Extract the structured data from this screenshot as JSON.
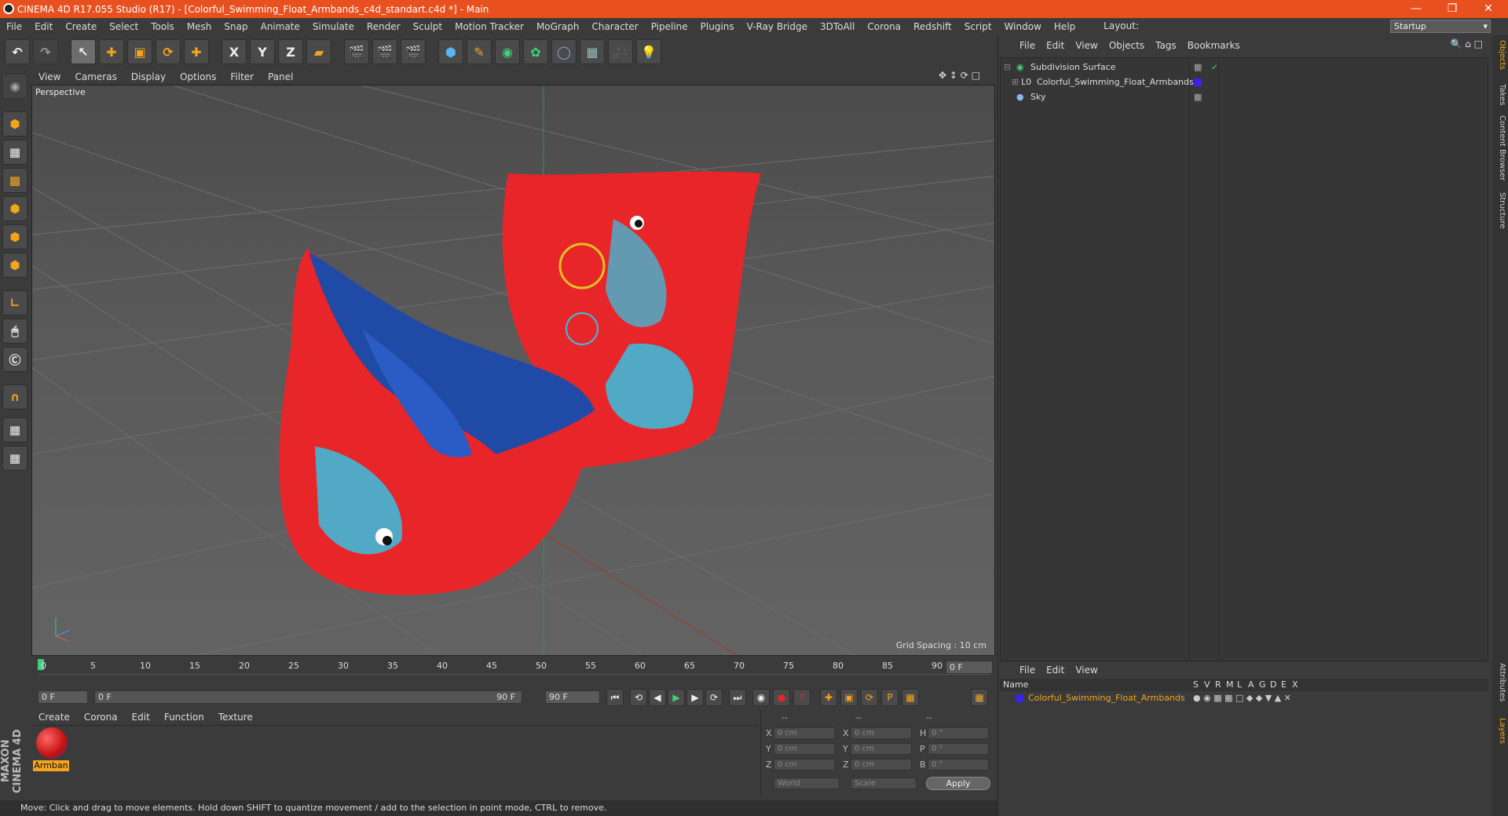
{
  "title": "CINEMA 4D R17.055 Studio (R17) - [Colorful_Swimming_Float_Armbands_c4d_standart.c4d *] - Main",
  "menu": [
    "File",
    "Edit",
    "Create",
    "Select",
    "Tools",
    "Mesh",
    "Snap",
    "Animate",
    "Simulate",
    "Render",
    "Sculpt",
    "Motion Tracker",
    "MoGraph",
    "Character",
    "Pipeline",
    "Plugins",
    "V-Ray Bridge",
    "3DToAll",
    "Corona",
    "Redshift",
    "Script",
    "Window",
    "Help"
  ],
  "layout": {
    "label": "Layout:",
    "value": "Startup"
  },
  "toolbar_axes": [
    "X",
    "Y",
    "Z"
  ],
  "viewport": {
    "menu": [
      "View",
      "Cameras",
      "Display",
      "Options",
      "Filter",
      "Panel"
    ],
    "label": "Perspective",
    "grid_spacing": "Grid Spacing : 10 cm"
  },
  "timeline": {
    "ticks": [
      "0",
      "5",
      "10",
      "15",
      "20",
      "25",
      "30",
      "35",
      "40",
      "45",
      "50",
      "55",
      "60",
      "65",
      "70",
      "75",
      "80",
      "85",
      "90"
    ],
    "frame_end_field": "0 F",
    "start": "0 F",
    "range_start": "0 F",
    "range_end": "90 F",
    "end": "90 F"
  },
  "material_manager": {
    "menu": [
      "Create",
      "Corona",
      "Edit",
      "Function",
      "Texture"
    ],
    "material_name": "Armban"
  },
  "coordinates": {
    "headers": [
      "--",
      "--",
      "--"
    ],
    "rows": [
      {
        "a": "X",
        "av": "0 cm",
        "b": "X",
        "bv": "0 cm",
        "c": "H",
        "cv": "0 °"
      },
      {
        "a": "Y",
        "av": "0 cm",
        "b": "Y",
        "bv": "0 cm",
        "c": "P",
        "cv": "0 °"
      },
      {
        "a": "Z",
        "av": "0 cm",
        "b": "Z",
        "bv": "0 cm",
        "c": "B",
        "cv": "0 °"
      }
    ],
    "space": "World",
    "mode": "Scale",
    "apply": "Apply"
  },
  "status": "Move: Click and drag to move elements. Hold down SHIFT to quantize movement / add to the selection in point mode, CTRL to remove.",
  "object_manager": {
    "menu": [
      "File",
      "Edit",
      "View",
      "Objects",
      "Tags",
      "Bookmarks"
    ],
    "objects": [
      "Subdivision Surface",
      "Colorful_Swimming_Float_Armbands",
      "Sky"
    ]
  },
  "layer_manager": {
    "menu": [
      "File",
      "Edit",
      "View"
    ],
    "name_header": "Name",
    "columns": [
      "S",
      "V",
      "R",
      "M",
      "L",
      "A",
      "G",
      "D",
      "E",
      "X"
    ],
    "layer": "Colorful_Swimming_Float_Armbands"
  },
  "side_tabs": [
    "Objects",
    "Takes",
    "Content Browser",
    "Structure",
    "Attributes",
    "Layers"
  ],
  "brand": "MAXON CINEMA 4D",
  "colors": {
    "titlebar": "#e8501f",
    "armband_red": "#e8262a",
    "armband_blue": "#1f4aa6",
    "pattern_cyan": "#37c1e0",
    "layer_orange": "#f2a51d"
  }
}
